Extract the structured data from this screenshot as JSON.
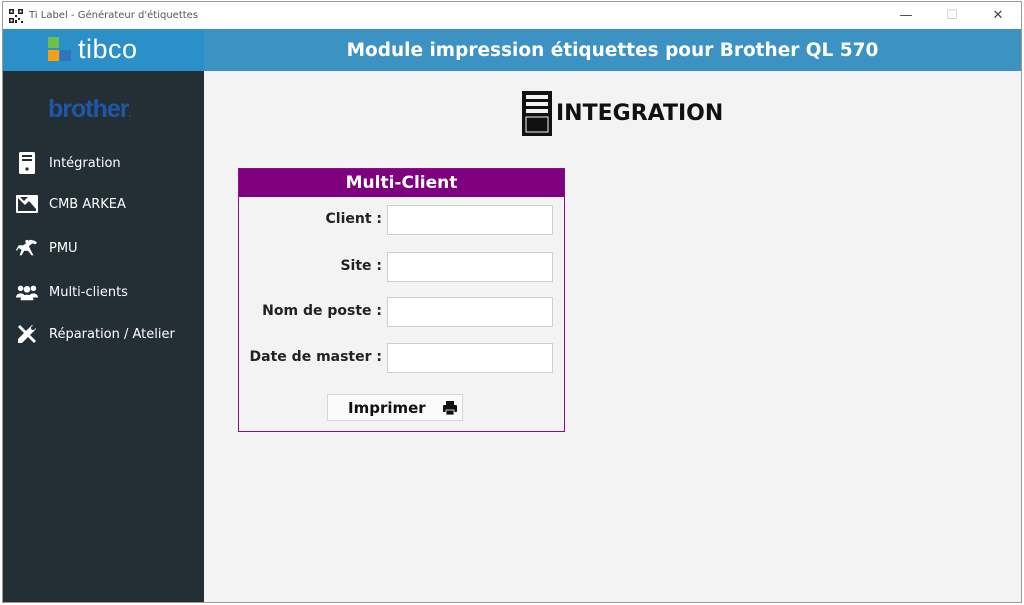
{
  "window": {
    "title": "Ti Label - Générateur d'étiquettes",
    "controls": {
      "minimize": "—",
      "maximize": "☐",
      "close": "✕"
    }
  },
  "brand": {
    "name": "tibco",
    "colors": {
      "green": "#6cc04a",
      "orange": "#f6a01a",
      "blue": "#2f74c0",
      "bar": "#2b8fc8"
    }
  },
  "header": {
    "title": "Module impression étiquettes pour Brother QL 570",
    "background": "#3d92c4"
  },
  "sidebar": {
    "logo": "brother",
    "background": "#232e35",
    "items": [
      {
        "label": "Intégration",
        "icon": "server-icon"
      },
      {
        "label": "CMB ARKEA",
        "icon": "map-icon"
      },
      {
        "label": "PMU",
        "icon": "horse-icon"
      },
      {
        "label": "Multi-clients",
        "icon": "users-icon"
      },
      {
        "label": "Réparation / Atelier",
        "icon": "tools-icon"
      }
    ]
  },
  "main": {
    "section_title": "INTEGRATION",
    "section_icon": "server-icon",
    "card": {
      "title": "Multi-Client",
      "accent": "#7e007e",
      "fields": [
        {
          "label": "Client :",
          "value": "",
          "placeholder": ""
        },
        {
          "label": "Site :",
          "value": "",
          "placeholder": ""
        },
        {
          "label": "Nom de poste :",
          "value": "",
          "placeholder": ""
        },
        {
          "label": "Date de master :",
          "value": "",
          "placeholder": ""
        }
      ],
      "print_button": {
        "label": "Imprimer",
        "icon": "printer-icon"
      }
    }
  }
}
